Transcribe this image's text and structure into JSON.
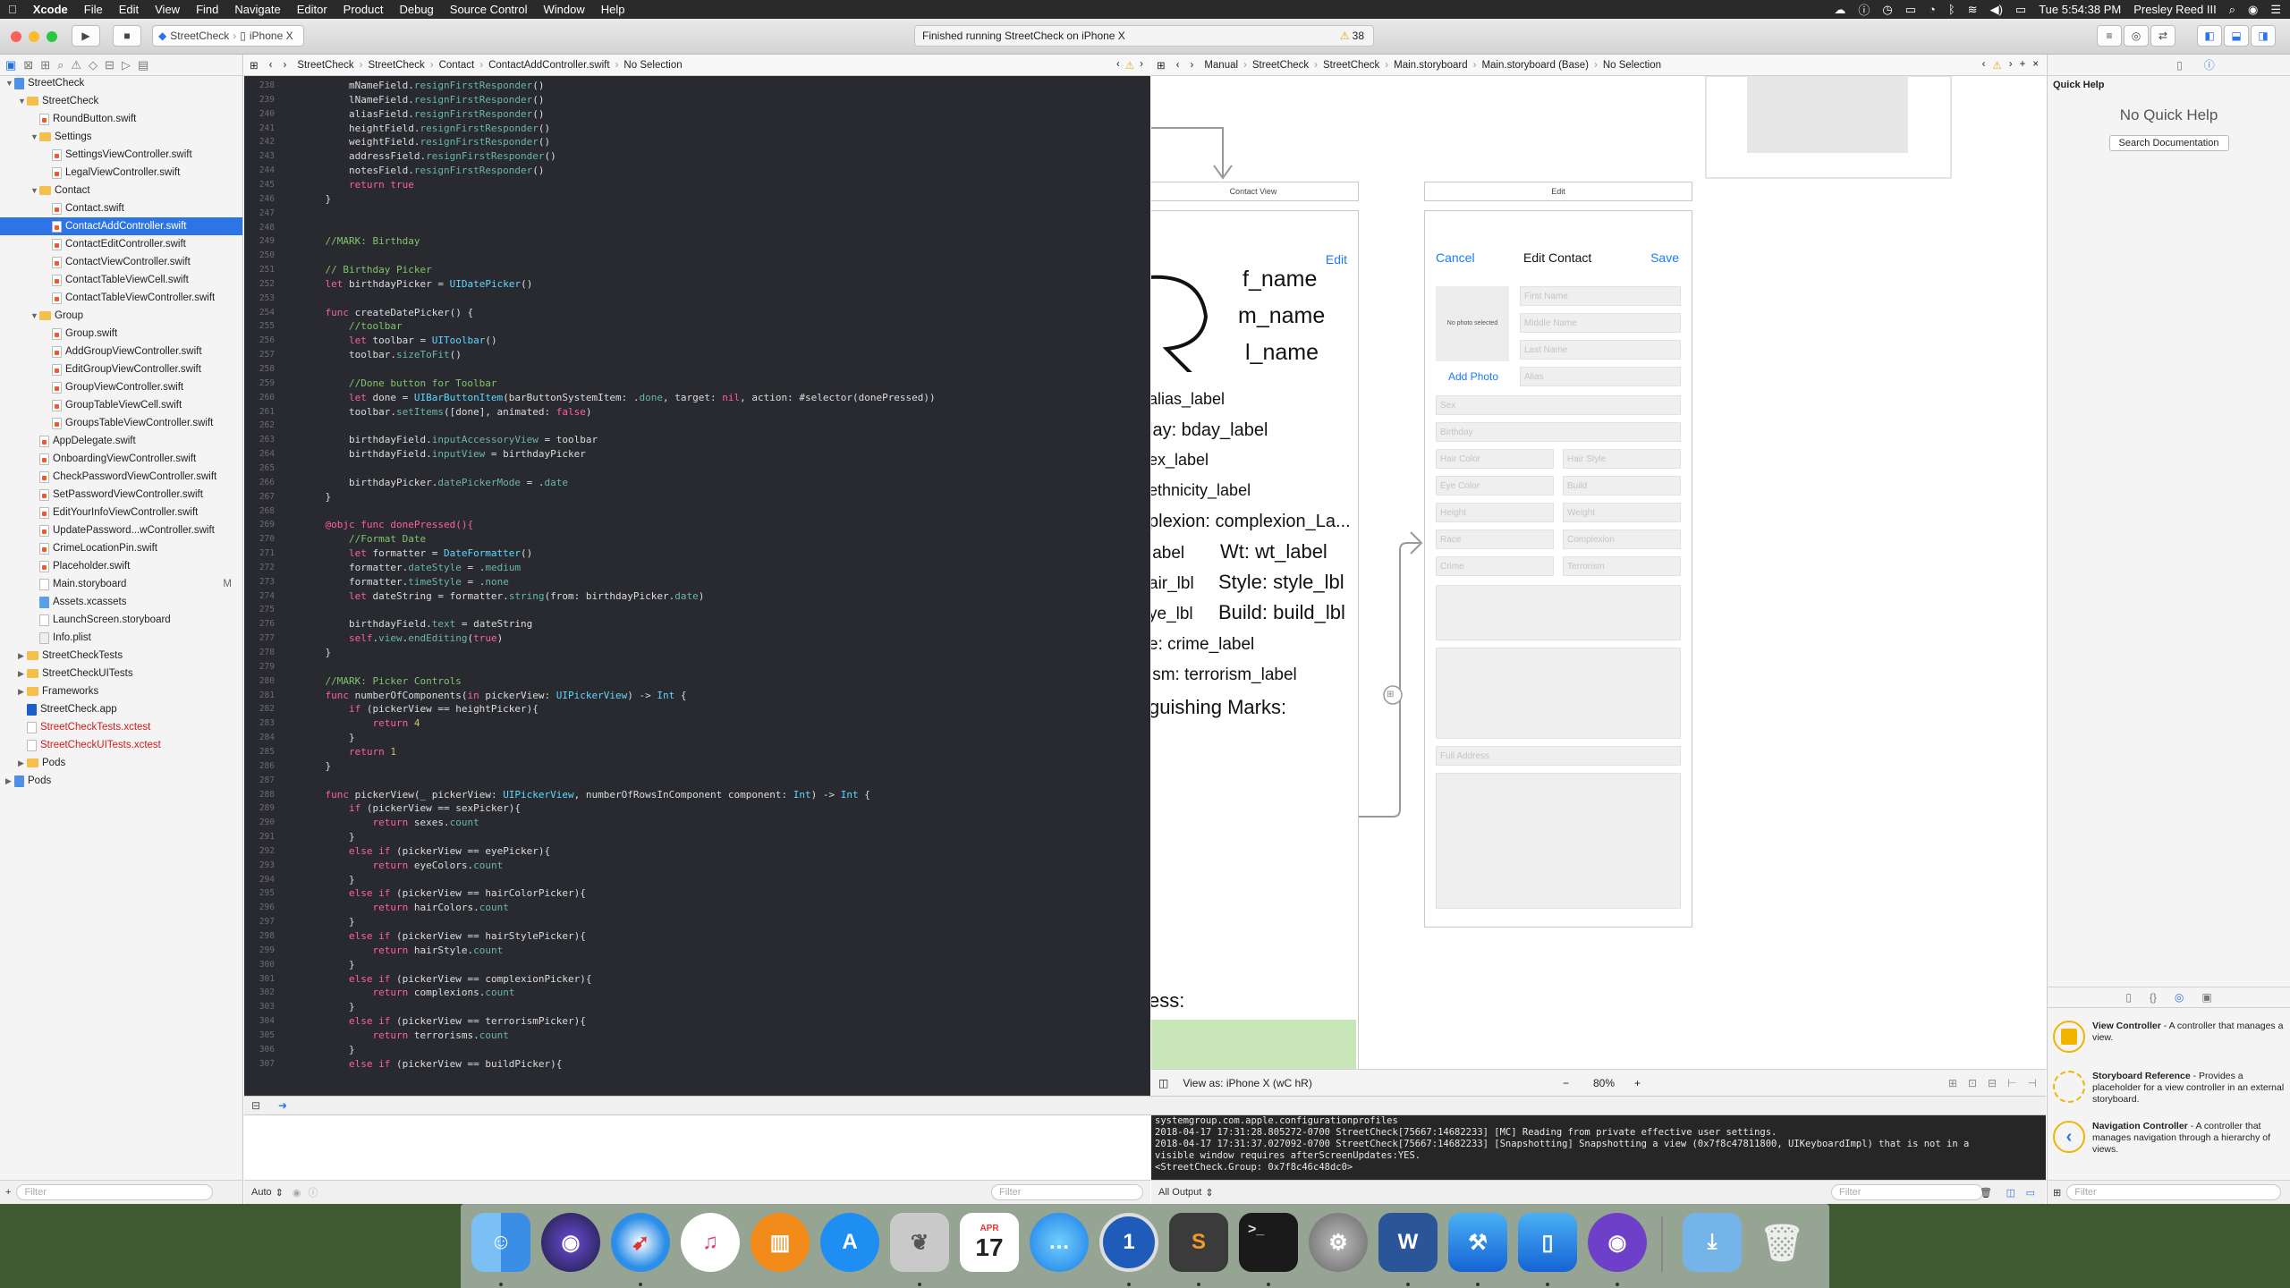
{
  "menubar": {
    "apple": "",
    "app": "Xcode",
    "items": [
      "File",
      "Edit",
      "View",
      "Find",
      "Navigate",
      "Editor",
      "Product",
      "Debug",
      "Source Control",
      "Window",
      "Help"
    ],
    "clock": "Tue 5:54:38 PM",
    "user": "Presley Reed III"
  },
  "toolbar": {
    "scheme": "StreetCheck",
    "device": "iPhone X",
    "status": "Finished running StreetCheck on iPhone X",
    "warnings": "38"
  },
  "navigator": {
    "items": [
      {
        "label": "StreetCheck",
        "indent": 0,
        "type": "project",
        "open": true
      },
      {
        "label": "StreetCheck",
        "indent": 1,
        "type": "folder",
        "open": true
      },
      {
        "label": "RoundButton.swift",
        "indent": 2,
        "type": "swift"
      },
      {
        "label": "Settings",
        "indent": 2,
        "type": "folder",
        "open": true
      },
      {
        "label": "SettingsViewController.swift",
        "indent": 3,
        "type": "swift"
      },
      {
        "label": "LegalViewController.swift",
        "indent": 3,
        "type": "swift"
      },
      {
        "label": "Contact",
        "indent": 2,
        "type": "folder",
        "open": true
      },
      {
        "label": "Contact.swift",
        "indent": 3,
        "type": "swift"
      },
      {
        "label": "ContactAddController.swift",
        "indent": 3,
        "type": "swift",
        "selected": true
      },
      {
        "label": "ContactEditController.swift",
        "indent": 3,
        "type": "swift"
      },
      {
        "label": "ContactViewController.swift",
        "indent": 3,
        "type": "swift"
      },
      {
        "label": "ContactTableViewCell.swift",
        "indent": 3,
        "type": "swift"
      },
      {
        "label": "ContactTableViewController.swift",
        "indent": 3,
        "type": "swift"
      },
      {
        "label": "Group",
        "indent": 2,
        "type": "folder",
        "open": true
      },
      {
        "label": "Group.swift",
        "indent": 3,
        "type": "swift"
      },
      {
        "label": "AddGroupViewController.swift",
        "indent": 3,
        "type": "swift"
      },
      {
        "label": "EditGroupViewController.swift",
        "indent": 3,
        "type": "swift"
      },
      {
        "label": "GroupViewController.swift",
        "indent": 3,
        "type": "swift"
      },
      {
        "label": "GroupTableViewCell.swift",
        "indent": 3,
        "type": "swift"
      },
      {
        "label": "GroupsTableViewController.swift",
        "indent": 3,
        "type": "swift"
      },
      {
        "label": "AppDelegate.swift",
        "indent": 2,
        "type": "swift"
      },
      {
        "label": "OnboardingViewController.swift",
        "indent": 2,
        "type": "swift"
      },
      {
        "label": "CheckPasswordViewController.swift",
        "indent": 2,
        "type": "swift"
      },
      {
        "label": "SetPasswordViewController.swift",
        "indent": 2,
        "type": "swift"
      },
      {
        "label": "EditYourInfoViewController.swift",
        "indent": 2,
        "type": "swift"
      },
      {
        "label": "UpdatePassword...wController.swift",
        "indent": 2,
        "type": "swift"
      },
      {
        "label": "CrimeLocationPin.swift",
        "indent": 2,
        "type": "swift"
      },
      {
        "label": "Placeholder.swift",
        "indent": 2,
        "type": "swift"
      },
      {
        "label": "Main.storyboard",
        "indent": 2,
        "type": "storyboard",
        "badge": "M"
      },
      {
        "label": "Assets.xcassets",
        "indent": 2,
        "type": "assets"
      },
      {
        "label": "LaunchScreen.storyboard",
        "indent": 2,
        "type": "storyboard"
      },
      {
        "label": "Info.plist",
        "indent": 2,
        "type": "plist"
      },
      {
        "label": "StreetCheckTests",
        "indent": 1,
        "type": "folder",
        "open": false
      },
      {
        "label": "StreetCheckUITests",
        "indent": 1,
        "type": "folder",
        "open": false
      },
      {
        "label": "Frameworks",
        "indent": 1,
        "type": "folder",
        "open": false
      },
      {
        "label": "StreetCheck.app",
        "indent": 1,
        "type": "app"
      },
      {
        "label": "StreetCheckTests.xctest",
        "indent": 1,
        "type": "xctest",
        "red": true
      },
      {
        "label": "StreetCheckUITests.xctest",
        "indent": 1,
        "type": "xctest",
        "red": true
      },
      {
        "label": "Pods",
        "indent": 1,
        "type": "folder",
        "open": false
      },
      {
        "label": "Pods",
        "indent": 0,
        "type": "project",
        "open": false
      }
    ],
    "filter_placeholder": "Filter"
  },
  "editor_jump": [
    "StreetCheck",
    "StreetCheck",
    "Contact",
    "ContactAddController.swift",
    "No Selection"
  ],
  "ib_jump": [
    "Manual",
    "StreetCheck",
    "StreetCheck",
    "Main.storyboard",
    "Main.storyboard (Base)",
    "No Selection"
  ],
  "code": [
    {
      "n": "238",
      "t": "        mNameField.resignFirstResponder()"
    },
    {
      "n": "239",
      "t": "        lNameField.resignFirstResponder()"
    },
    {
      "n": "240",
      "t": "        aliasField.resignFirstResponder()"
    },
    {
      "n": "241",
      "t": "        heightField.resignFirstResponder()"
    },
    {
      "n": "242",
      "t": "        weightField.resignFirstResponder()"
    },
    {
      "n": "243",
      "t": "        addressField.resignFirstResponder()"
    },
    {
      "n": "244",
      "t": "        notesField.resignFirstResponder()"
    },
    {
      "n": "245",
      "t": "        return true"
    },
    {
      "n": "246",
      "t": "    }"
    },
    {
      "n": "247",
      "t": ""
    },
    {
      "n": "248",
      "t": ""
    },
    {
      "n": "249",
      "t": "    //MARK: Birthday"
    },
    {
      "n": "250",
      "t": ""
    },
    {
      "n": "251",
      "t": "    // Birthday Picker"
    },
    {
      "n": "252",
      "t": "    let birthdayPicker = UIDatePicker()"
    },
    {
      "n": "253",
      "t": ""
    },
    {
      "n": "254",
      "t": "    func createDatePicker() {"
    },
    {
      "n": "255",
      "t": "        //toolbar"
    },
    {
      "n": "256",
      "t": "        let toolbar = UIToolbar()"
    },
    {
      "n": "257",
      "t": "        toolbar.sizeToFit()"
    },
    {
      "n": "258",
      "t": ""
    },
    {
      "n": "259",
      "t": "        //Done button for Toolbar"
    },
    {
      "n": "260",
      "t": "        let done = UIBarButtonItem(barButtonSystemItem: .done, target: nil, action: #selector(donePressed))"
    },
    {
      "n": "261",
      "t": "        toolbar.setItems([done], animated: false)"
    },
    {
      "n": "262",
      "t": ""
    },
    {
      "n": "263",
      "t": "        birthdayField.inputAccessoryView = toolbar"
    },
    {
      "n": "264",
      "t": "        birthdayField.inputView = birthdayPicker"
    },
    {
      "n": "265",
      "t": ""
    },
    {
      "n": "266",
      "t": "        birthdayPicker.datePickerMode = .date"
    },
    {
      "n": "267",
      "t": "    }"
    },
    {
      "n": "268",
      "t": ""
    },
    {
      "n": "269",
      "t": "    @objc func donePressed(){"
    },
    {
      "n": "270",
      "t": "        //Format Date"
    },
    {
      "n": "271",
      "t": "        let formatter = DateFormatter()"
    },
    {
      "n": "272",
      "t": "        formatter.dateStyle = .medium"
    },
    {
      "n": "273",
      "t": "        formatter.timeStyle = .none"
    },
    {
      "n": "274",
      "t": "        let dateString = formatter.string(from: birthdayPicker.date)"
    },
    {
      "n": "275",
      "t": ""
    },
    {
      "n": "276",
      "t": "        birthdayField.text = dateString"
    },
    {
      "n": "277",
      "t": "        self.view.endEditing(true)"
    },
    {
      "n": "278",
      "t": "    }"
    },
    {
      "n": "279",
      "t": ""
    },
    {
      "n": "280",
      "t": "    //MARK: Picker Controls"
    },
    {
      "n": "281",
      "t": "    func numberOfComponents(in pickerView: UIPickerView) -> Int {"
    },
    {
      "n": "282",
      "t": "        if (pickerView == heightPicker){"
    },
    {
      "n": "283",
      "t": "            return 4"
    },
    {
      "n": "284",
      "t": "        }"
    },
    {
      "n": "285",
      "t": "        return 1"
    },
    {
      "n": "286",
      "t": "    }"
    },
    {
      "n": "287",
      "t": ""
    },
    {
      "n": "288",
      "t": "    func pickerView(_ pickerView: UIPickerView, numberOfRowsInComponent component: Int) -> Int {"
    },
    {
      "n": "289",
      "t": "        if (pickerView == sexPicker){"
    },
    {
      "n": "290",
      "t": "            return sexes.count"
    },
    {
      "n": "291",
      "t": "        }"
    },
    {
      "n": "292",
      "t": "        else if (pickerView == eyePicker){"
    },
    {
      "n": "293",
      "t": "            return eyeColors.count"
    },
    {
      "n": "294",
      "t": "        }"
    },
    {
      "n": "295",
      "t": "        else if (pickerView == hairColorPicker){"
    },
    {
      "n": "296",
      "t": "            return hairColors.count"
    },
    {
      "n": "297",
      "t": "        }"
    },
    {
      "n": "298",
      "t": "        else if (pickerView == hairStylePicker){"
    },
    {
      "n": "299",
      "t": "            return hairStyle.count"
    },
    {
      "n": "300",
      "t": "        }"
    },
    {
      "n": "301",
      "t": "        else if (pickerView == complexionPicker){"
    },
    {
      "n": "302",
      "t": "            return complexions.count"
    },
    {
      "n": "303",
      "t": "        }"
    },
    {
      "n": "304",
      "t": "        else if (pickerView == terrorismPicker){"
    },
    {
      "n": "305",
      "t": "            return terrorisms.count"
    },
    {
      "n": "306",
      "t": "        }"
    },
    {
      "n": "307",
      "t": "        else if (pickerView == buildPicker){"
    }
  ],
  "ib": {
    "contact_view_title": "Contact View",
    "edit_scene_title": "Edit",
    "edit_button": "Edit",
    "labels_right": [
      "f_name",
      "m_name",
      "l_name"
    ],
    "labels": [
      "alias_label",
      "lay: bday_label",
      "ex_label",
      "ethnicity_label",
      "plexion: complexion_La...",
      "label",
      "Wt: wt_label",
      "air_lbl",
      "Style: style_lbl",
      "ye_lbl",
      "Build: build_lbl",
      "e: crime_label",
      "ism: terrorism_label",
      "guishing Marks:",
      "ess:"
    ],
    "nav_cancel": "Cancel",
    "nav_title": "Edit Contact",
    "nav_save": "Save",
    "photo_placeholder": "No photo selected",
    "add_photo": "Add Photo",
    "fields": {
      "first": "First Name",
      "middle": "Middle Name",
      "last": "Last Name",
      "alias": "Alias",
      "sex": "Sex",
      "birthday": "Birthday",
      "hair_color": "Hair Color",
      "hair_style": "Hair Style",
      "eye_color": "Eye Color",
      "build": "Build",
      "height": "Height",
      "weight": "Weight",
      "race": "Race",
      "complexion": "Complexion",
      "crime": "Crime",
      "terrorism": "Terrorism",
      "address": "Full Address"
    },
    "view_as": "View as: iPhone X (wC hR)",
    "zoom": "80%"
  },
  "console": [
    "systemgroup.com.apple.configurationprofiles",
    "2018-04-17 17:31:28.805272-0700 StreetCheck[75667:14682233] [MC] Reading from private effective user settings.",
    "2018-04-17 17:31:37.027092-0700 StreetCheck[75667:14682233] [Snapshotting] Snapshotting a view (0x7f8c47811800, UIKeyboardImpl) that is not in a",
    "visible window requires afterScreenUpdates:YES.",
    "<StreetCheck.Group: 0x7f8c46c48dc0>"
  ],
  "debug": {
    "auto": "Auto",
    "all_output": "All Output",
    "filter": "Filter"
  },
  "inspector": {
    "quick_help_title": "Quick Help",
    "no_quick_help": "No Quick Help",
    "search_docs": "Search Documentation",
    "library": [
      {
        "name": "View Controller",
        "desc": "- A controller that manages a view."
      },
      {
        "name": "Storyboard Reference",
        "desc": "- Provides a placeholder for a view controller in an external storyboard."
      },
      {
        "name": "Navigation Controller",
        "desc": "- A controller that manages navigation through a hierarchy of views."
      }
    ],
    "filter": "Filter"
  },
  "dock": {
    "calendar_month": "APR",
    "calendar_day": "17",
    "apps": [
      "Finder",
      "Siri",
      "Safari",
      "iTunes",
      "iBooks",
      "App Store",
      "Preview",
      "Calendar",
      "Messages",
      "1Password",
      "Sublime Text",
      "Terminal",
      "System Preferences",
      "Microsoft Word",
      "Xcode",
      "Simulator",
      "GitHub Desktop",
      "Downloads",
      "Trash"
    ]
  }
}
